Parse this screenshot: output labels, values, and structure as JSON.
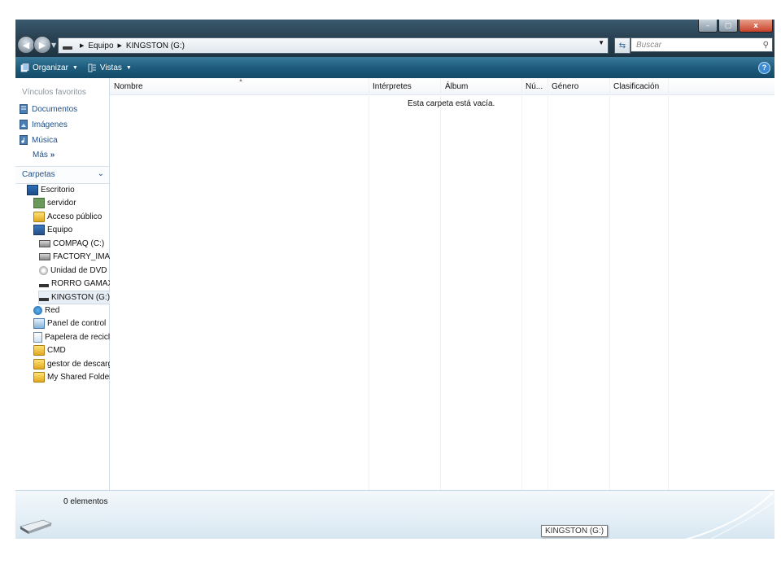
{
  "window": {
    "controls": {
      "minimize": "–",
      "maximize": "▢",
      "close": "x"
    }
  },
  "address": {
    "breadcrumbs": [
      "Equipo",
      "KINGSTON (G:)"
    ],
    "search_placeholder": "Buscar"
  },
  "toolbar": {
    "organize_label": "Organizar",
    "views_label": "Vistas",
    "help": "?"
  },
  "nav": {
    "favorites_header": "Vínculos favoritos",
    "favorites": [
      {
        "label": "Documentos",
        "icon": "documents-icon"
      },
      {
        "label": "Imágenes",
        "icon": "images-icon"
      },
      {
        "label": "Música",
        "icon": "music-icon"
      }
    ],
    "more_label": "Más",
    "folders_header": "Carpetas",
    "tree": [
      {
        "label": "Escritorio",
        "icon": "desktop-icon",
        "level": 0
      },
      {
        "label": "servidor",
        "icon": "user-folder-icon",
        "level": 1
      },
      {
        "label": "Acceso público",
        "icon": "folder-icon",
        "level": 1
      },
      {
        "label": "Equipo",
        "icon": "computer-icon",
        "level": 1
      },
      {
        "label": "COMPAQ (C:)",
        "icon": "hard-drive-icon",
        "level": 2
      },
      {
        "label": "FACTORY_IMAGE",
        "icon": "hard-drive-icon",
        "level": 2
      },
      {
        "label": "Unidad de DVD RW",
        "icon": "dvd-drive-icon",
        "level": 2
      },
      {
        "label": "RORRO GAMAX (F",
        "icon": "usb-drive-icon",
        "level": 2
      },
      {
        "label": "KINGSTON (G:)",
        "icon": "usb-drive-icon",
        "level": 2,
        "selected": true
      },
      {
        "label": "Red",
        "icon": "network-icon",
        "level": 1
      },
      {
        "label": "Panel de control",
        "icon": "control-panel-icon",
        "level": 1
      },
      {
        "label": "Papelera de reciclaje",
        "icon": "recycle-bin-icon",
        "level": 1
      },
      {
        "label": "CMD",
        "icon": "folder-icon",
        "level": 1
      },
      {
        "label": "gestor de descarga",
        "icon": "folder-icon",
        "level": 1
      },
      {
        "label": "My Shared Folder",
        "icon": "folder-icon",
        "level": 1
      }
    ]
  },
  "content": {
    "columns": [
      "Nombre",
      "Intérpretes",
      "Álbum",
      "Nú...",
      "Género",
      "Clasificación"
    ],
    "empty_message": "Esta carpeta está vacía."
  },
  "details": {
    "item_count": "0 elementos",
    "tooltip": "KINGSTON (G:)"
  }
}
